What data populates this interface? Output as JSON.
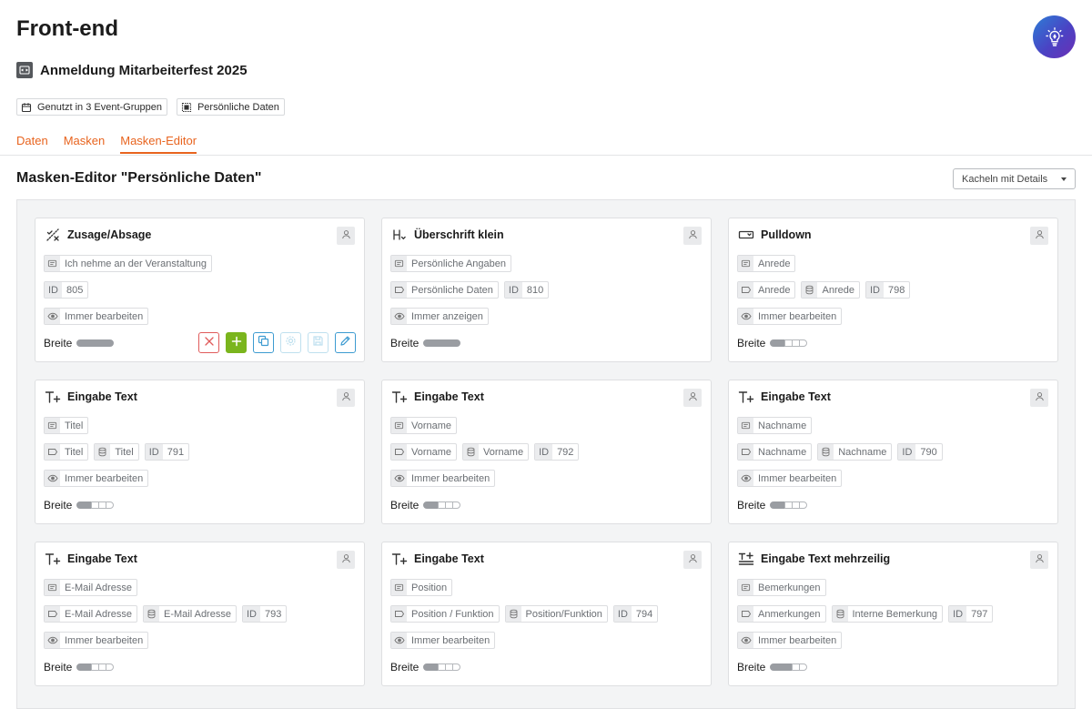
{
  "app": {
    "title": "Front-end",
    "project_title": "Anmeldung Mitarbeiterfest 2025",
    "chips": [
      {
        "icon": "calendar-icon",
        "label": "Genutzt in 3 Event-Gruppen"
      },
      {
        "icon": "mask-icon",
        "label": "Persönliche Daten"
      }
    ],
    "avatar_icon": "lightbulb-icon",
    "accent_color": "#e8641f"
  },
  "tabs": [
    {
      "label": "Daten",
      "active": false
    },
    {
      "label": "Masken",
      "active": false
    },
    {
      "label": "Masken-Editor",
      "active": true
    }
  ],
  "editor": {
    "title": "Masken-Editor \"Persönliche Daten\"",
    "view_select": {
      "selected": "Kacheln mit Details"
    },
    "width_label": "Breite"
  },
  "cards": [
    {
      "type": "Zusage/Absage",
      "icon": "zusage-absage-icon",
      "label": "Ich nehme an der Veranstaltung",
      "id_tag": "ID",
      "id": "805",
      "visibility": "Immer bearbeiten",
      "width_level": 5,
      "selected": true
    },
    {
      "type": "Überschrift klein",
      "icon": "heading-small-icon",
      "label": "Persönliche Angaben",
      "tag": "Persönliche Daten",
      "id_tag": "ID",
      "id": "810",
      "visibility": "Immer anzeigen",
      "width_level": 5
    },
    {
      "type": "Pulldown",
      "icon": "pulldown-icon",
      "label": "Anrede",
      "tag": "Anrede",
      "db_field": "Anrede",
      "id_tag": "ID",
      "id": "798",
      "visibility": "Immer bearbeiten",
      "width_level": 2
    },
    {
      "type": "Eingabe Text",
      "icon": "text-input-icon",
      "label": "Titel",
      "tag": "Titel",
      "db_field": "Titel",
      "id_tag": "ID",
      "id": "791",
      "visibility": "Immer bearbeiten",
      "width_level": 2
    },
    {
      "type": "Eingabe Text",
      "icon": "text-input-icon",
      "label": "Vorname",
      "tag": "Vorname",
      "db_field": "Vorname",
      "id_tag": "ID",
      "id": "792",
      "visibility": "Immer bearbeiten",
      "width_level": 2
    },
    {
      "type": "Eingabe Text",
      "icon": "text-input-icon",
      "label": "Nachname",
      "tag": "Nachname",
      "db_field": "Nachname",
      "id_tag": "ID",
      "id": "790",
      "visibility": "Immer bearbeiten",
      "width_level": 2
    },
    {
      "type": "Eingabe Text",
      "icon": "text-input-icon",
      "label": "E-Mail Adresse",
      "tag": "E-Mail Adresse",
      "db_field": "E-Mail Adresse",
      "id_tag": "ID",
      "id": "793",
      "visibility": "Immer bearbeiten",
      "width_level": 2
    },
    {
      "type": "Eingabe Text",
      "icon": "text-input-icon",
      "label": "Position",
      "tag": "Position / Funktion",
      "db_field": "Position/Funktion",
      "id_tag": "ID",
      "id": "794",
      "visibility": "Immer bearbeiten",
      "width_level": 2
    },
    {
      "type": "Eingabe Text mehrzeilig",
      "icon": "multiline-text-input-icon",
      "label": "Bemerkungen",
      "tag": "Anmerkungen",
      "db_field": "Interne Bemerkung",
      "id_tag": "ID",
      "id": "797",
      "visibility": "Immer bearbeiten",
      "width_level": 3
    }
  ],
  "card_actions": [
    {
      "name": "delete-button",
      "icon": "close-icon",
      "color": "#e05b5b"
    },
    {
      "name": "add-button",
      "icon": "plus-icon",
      "color": "#7ab51d"
    },
    {
      "name": "copy-button",
      "icon": "copy-icon",
      "color": "#3d9bd1"
    },
    {
      "name": "settings-button",
      "icon": "gear-icon",
      "color": "#bfe0ef"
    },
    {
      "name": "save-button",
      "icon": "save-icon",
      "color": "#bfe0ef"
    },
    {
      "name": "edit-button",
      "icon": "pencil-icon",
      "color": "#3d9bd1"
    }
  ]
}
